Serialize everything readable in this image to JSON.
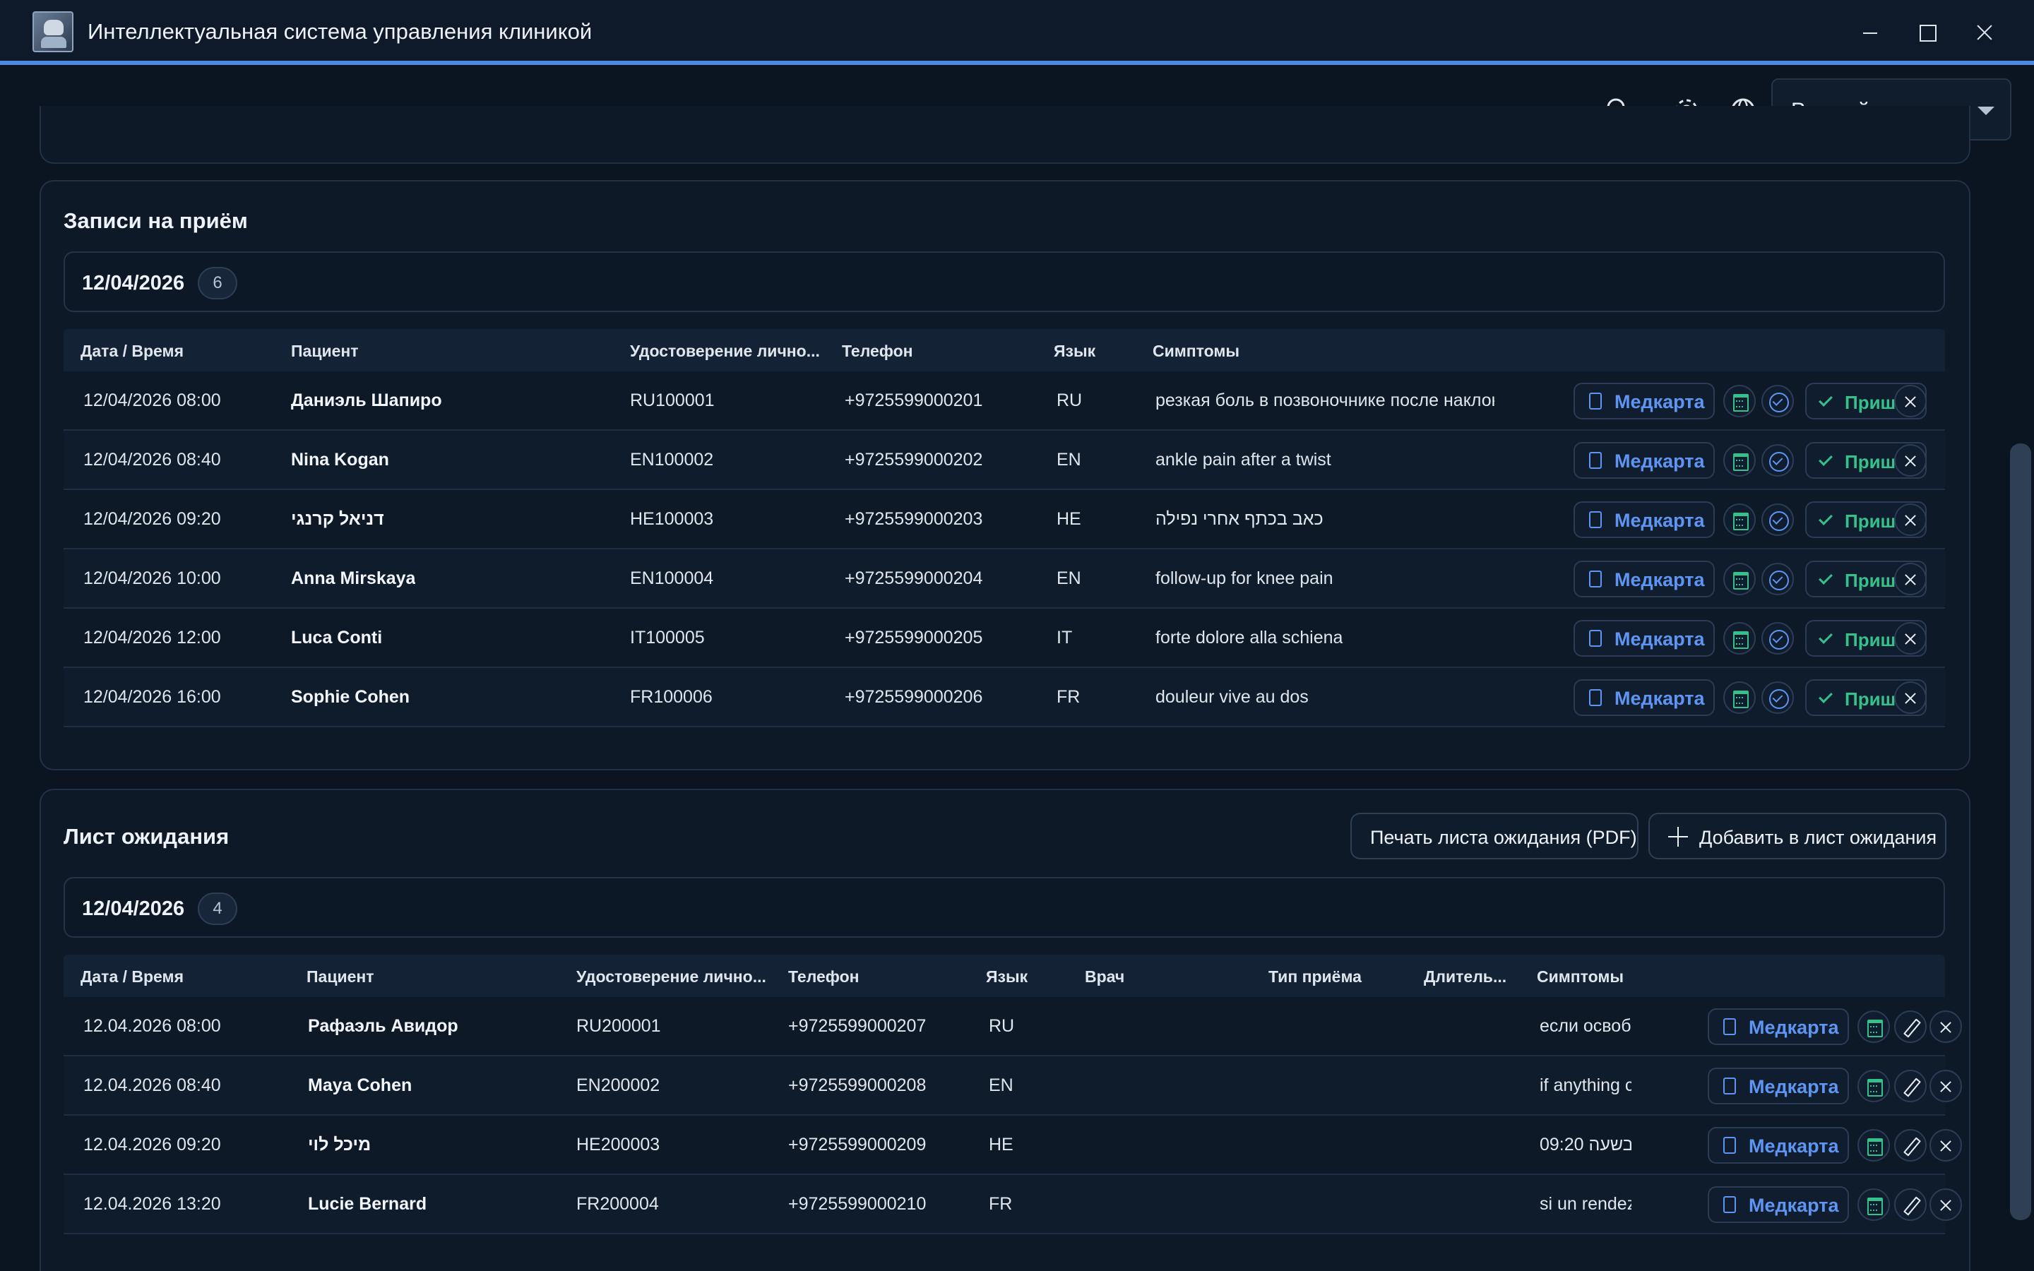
{
  "window": {
    "title": "Интеллектуальная система управления клиникой"
  },
  "toolbar": {
    "language": "Русский"
  },
  "appointments": {
    "title": "Записи на приём",
    "date": "12/04/2026",
    "count": "6",
    "columns": [
      "Дата / Время",
      "Пациент",
      "Удостоверение лично...",
      "Телефон",
      "Язык",
      "Симптомы"
    ],
    "card_label": "Медкарта",
    "arrived_label": "Пришёл",
    "rows": [
      {
        "datetime": "12/04/2026 08:00",
        "patient": "Даниэль Шапиро",
        "id": "RU100001",
        "phone": "+9725599000201",
        "lang": "RU",
        "symptoms": "резкая боль в позвоночнике после наклона"
      },
      {
        "datetime": "12/04/2026 08:40",
        "patient": "Nina Kogan",
        "id": "EN100002",
        "phone": "+9725599000202",
        "lang": "EN",
        "symptoms": "ankle pain after a twist"
      },
      {
        "datetime": "12/04/2026 09:20",
        "patient": "דניאל קרנגי",
        "id": "HE100003",
        "phone": "+9725599000203",
        "lang": "HE",
        "symptoms": "כאב בכתף אחרי נפילה"
      },
      {
        "datetime": "12/04/2026 10:00",
        "patient": "Anna Mirskaya",
        "id": "EN100004",
        "phone": "+9725599000204",
        "lang": "EN",
        "symptoms": "follow-up for knee pain"
      },
      {
        "datetime": "12/04/2026 12:00",
        "patient": "Luca Conti",
        "id": "IT100005",
        "phone": "+9725599000205",
        "lang": "IT",
        "symptoms": "forte dolore alla schiena"
      },
      {
        "datetime": "12/04/2026 16:00",
        "patient": "Sophie Cohen",
        "id": "FR100006",
        "phone": "+9725599000206",
        "lang": "FR",
        "symptoms": "douleur vive au dos"
      }
    ]
  },
  "waitlist": {
    "title": "Лист ожидания",
    "print_label": "Печать листа ожидания (PDF)",
    "add_label": "Добавить в лист ожидания",
    "date": "12/04/2026",
    "count": "4",
    "columns": [
      "Дата / Время",
      "Пациент",
      "Удостоверение лично...",
      "Телефон",
      "Язык",
      "Врач",
      "Тип приёма",
      "Длитель...",
      "Симптомы"
    ],
    "card_label": "Медкарта",
    "rows": [
      {
        "datetime": "12.04.2026 08:00",
        "patient": "Рафаэль Авидор",
        "id": "RU200001",
        "phone": "+9725599000207",
        "lang": "RU",
        "symptoms": "если освобо"
      },
      {
        "datetime": "12.04.2026 08:40",
        "patient": "Maya Cohen",
        "id": "EN200002",
        "phone": "+9725599000208",
        "lang": "EN",
        "symptoms": "if anything c"
      },
      {
        "datetime": "12.04.2026 09:20",
        "patient": "מיכל לוי",
        "id": "HE200003",
        "phone": "+9725599000209",
        "lang": "HE",
        "symptoms": "בשעה 09:20"
      },
      {
        "datetime": "12.04.2026 13:20",
        "patient": "Lucie Bernard",
        "id": "FR200004",
        "phone": "+9725599000210",
        "lang": "FR",
        "symptoms": "si un rendez"
      }
    ]
  }
}
